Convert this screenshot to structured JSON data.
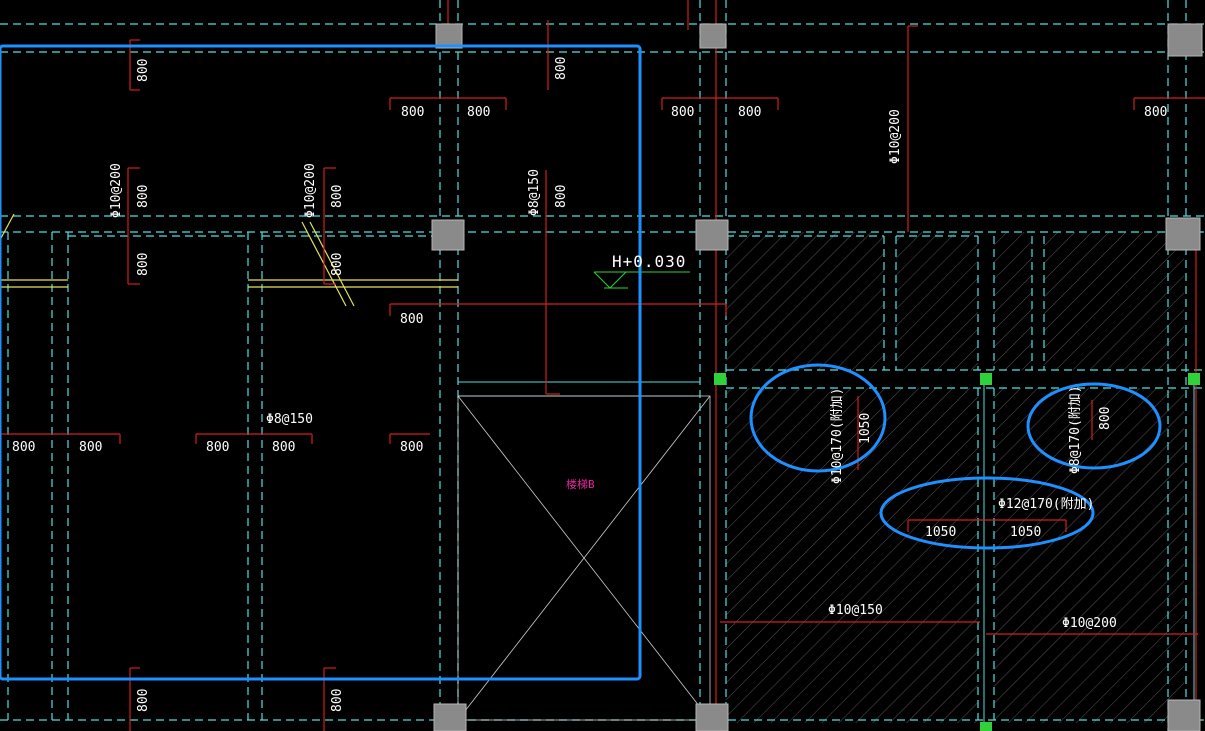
{
  "drawing": {
    "background": "#000000",
    "colors": {
      "axis_cyan": "#4fe0e0",
      "rebar_red": "#d21f1f",
      "beam_yellow": "#e6e25a",
      "column_gray": "#8a8a8a",
      "highlight_blue": "#1e90ff",
      "text_white": "#ffffff",
      "text_magenta": "#e0289b",
      "level_green": "#2fd23a",
      "hatch_gray": "#6a6a6a"
    },
    "elevation_mark": "H+0.030",
    "stair_label": "楼梯B",
    "spans_horizontal": {
      "top_row": [
        "800",
        "800",
        "800",
        "800",
        "800"
      ],
      "mid_800": "800",
      "left_row": [
        "800",
        "800",
        "800",
        "800",
        "800"
      ],
      "right_1050": [
        "1050",
        "1050"
      ]
    },
    "spans_vertical": {
      "upper": [
        "800",
        "800",
        "800"
      ],
      "middle": [
        "800",
        "800",
        "800",
        "800",
        "800"
      ],
      "bottom": [
        "800",
        "800"
      ],
      "right_1050": "1050",
      "right_800": "800"
    },
    "rebar_specs": {
      "left_a": "Φ10@200",
      "left_b": "Φ10@200",
      "stair_side": "Φ8@150",
      "right_top": "Φ10@200",
      "mid_horizontal": "Φ8@150",
      "circled_left": "Φ10@170(附加)",
      "circled_right": "Φ8@170(附加)",
      "circled_bottom": "Φ12@170(附加)",
      "bottom_left": "Φ10@150",
      "bottom_right": "Φ10@200"
    }
  }
}
